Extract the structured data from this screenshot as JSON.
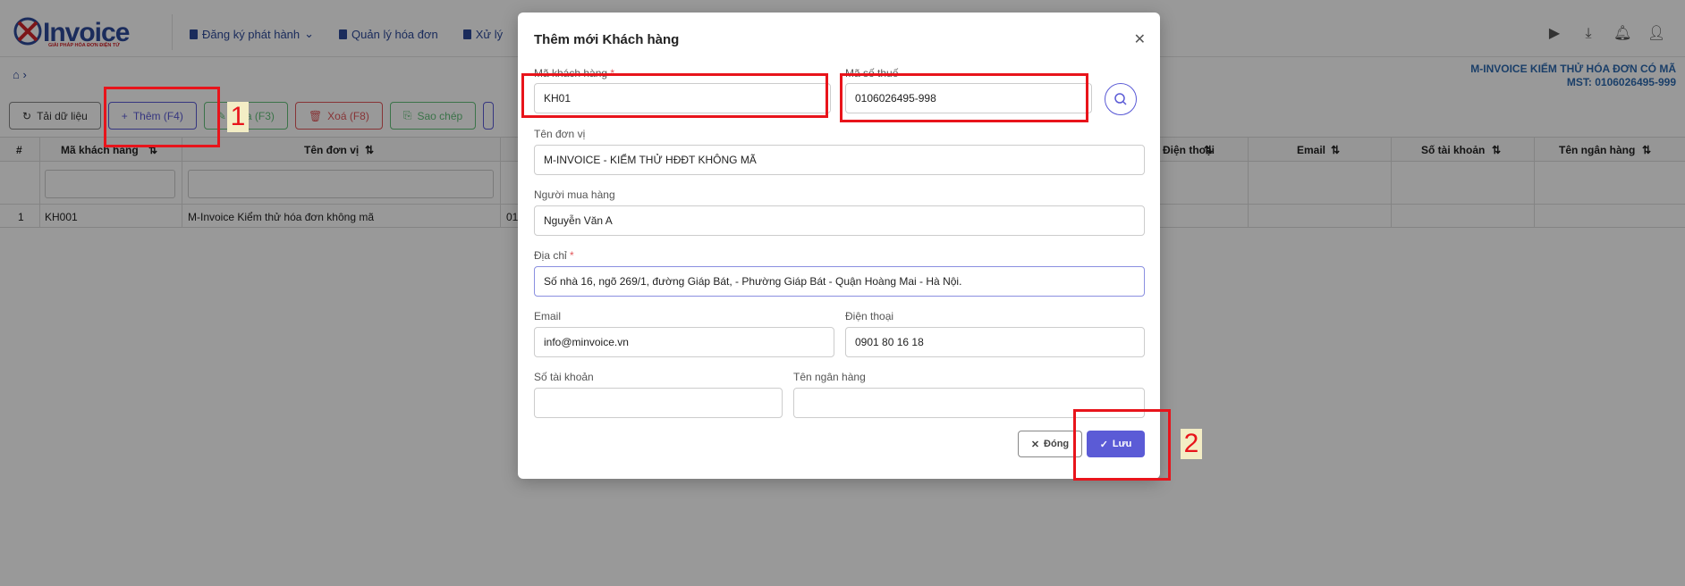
{
  "app": {
    "logo_text": "Invoice",
    "logo_tagline": "GIẢI PHÁP HÓA ĐƠN ĐIỆN TỬ",
    "menu": [
      {
        "label": "Đăng ký phát hành"
      },
      {
        "label": "Quản lý hóa đơn"
      },
      {
        "label": "Xử lý"
      }
    ],
    "company_name": "M-INVOICE KIỂM THỬ HÓA ĐƠN CÓ MÃ",
    "company_tax": "MST: 0106026495-999"
  },
  "toolbar": {
    "reload": "Tải dữ liệu",
    "add": "Thêm (F4)",
    "edit": "Sửa (F3)",
    "delete": "Xoá (F8)",
    "copy": "Sao chép"
  },
  "grid": {
    "columns": {
      "index": "#",
      "code": "Mã khách hàng",
      "name": "Tên đơn vị",
      "phone": "Điện thoại",
      "email": "Email",
      "account": "Số tài khoản",
      "bank": "Tên ngân hàng"
    },
    "rows": [
      {
        "index": "1",
        "code": "KH001",
        "name": "M-Invoice Kiểm thử hóa đơn không mã",
        "tax_partial": "01"
      }
    ]
  },
  "modal": {
    "title": "Thêm mới Khách hàng",
    "fields": {
      "code_label": "Mã khách hàng",
      "code_value": "KH01",
      "tax_label": "Mã số thuế",
      "tax_value": "0106026495-998",
      "unit_label": "Tên đơn vị",
      "unit_value": "M-INVOICE - KIỂM THỬ HĐĐT KHÔNG MÃ",
      "buyer_label": "Người mua hàng",
      "buyer_value": "Nguyễn Văn A",
      "address_label": "Địa chỉ",
      "address_value": "Số nhà 16, ngõ 269/1, đường Giáp Bát, - Phường Giáp Bát - Quận Hoàng Mai - Hà Nội.",
      "email_label": "Email",
      "email_value": "info@minvoice.vn",
      "phone_label": "Điện thoại",
      "phone_value": "0901 80 16 18",
      "account_label": "Số tài khoản",
      "account_value": "",
      "bank_label": "Tên ngân hàng",
      "bank_value": ""
    },
    "close_label": "Đóng",
    "save_label": "Lưu"
  },
  "annotations": {
    "step1": "1",
    "step2": "2"
  },
  "colors": {
    "primary": "#5b5bd6",
    "brand_blue": "#2d4a9a",
    "annotation_red": "#e8141b"
  }
}
